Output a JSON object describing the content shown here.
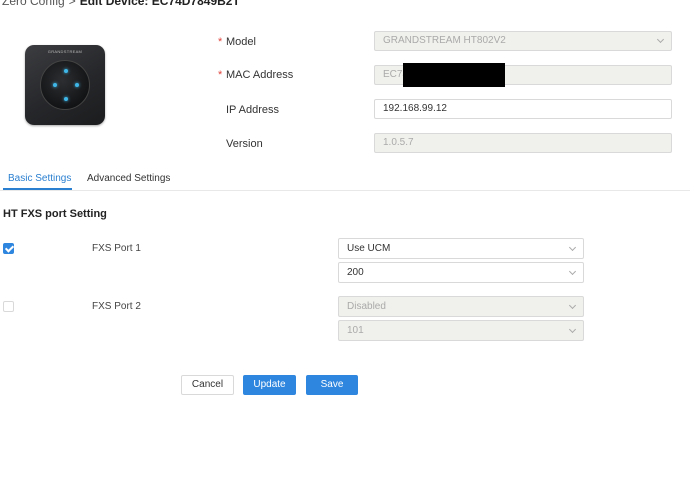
{
  "breadcrumb": {
    "parent": "Zero Config",
    "separator": ">",
    "current": "Edit Device: EC74D7849B2T"
  },
  "device": {
    "brand_text": "GRANDSTREAM",
    "fields": {
      "model": {
        "label": "Model",
        "value": "GRANDSTREAM HT802V2",
        "required": true,
        "icon": "chevron-down-icon"
      },
      "mac": {
        "label": "MAC Address",
        "value": "EC74",
        "required": true,
        "redacted": true
      },
      "ip": {
        "label": "IP Address",
        "value": "192.168.99.12",
        "required": false
      },
      "version": {
        "label": "Version",
        "value": "1.0.5.7",
        "required": false
      }
    },
    "required_marker": "*"
  },
  "tabs": [
    {
      "label": "Basic Settings",
      "active": true
    },
    {
      "label": "Advanced Settings",
      "active": false
    }
  ],
  "section": {
    "title": "HT FXS port Setting"
  },
  "ports": [
    {
      "label": "FXS Port 1",
      "enabled": true,
      "mode": "Use UCM",
      "extension": "200"
    },
    {
      "label": "FXS Port 2",
      "enabled": false,
      "mode": "Disabled",
      "extension": "101"
    }
  ],
  "actions": {
    "cancel": "Cancel",
    "update": "Update",
    "save": "Save"
  },
  "colors": {
    "primary": "#2f86de",
    "required": "#e0443c",
    "disabled_bg": "#f0f0ec",
    "tab_active": "#2a7fd0"
  }
}
